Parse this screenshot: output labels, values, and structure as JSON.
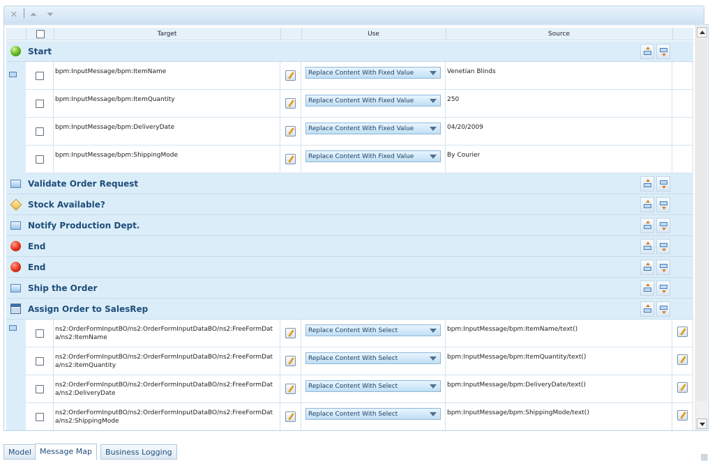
{
  "toolbar": {
    "delete_icon": "close-icon",
    "move_up_icon": "arrow-up-icon",
    "move_down_icon": "arrow-down-icon"
  },
  "columns": {
    "target": "Target",
    "use": "Use",
    "source": "Source"
  },
  "groups": {
    "start": "Start",
    "validate": "Validate Order Request",
    "stock": "Stock Available?",
    "notify": "Notify Production Dept.",
    "end1": "End",
    "end2": "End",
    "ship": "Ship the Order",
    "assign": "Assign Order to SalesRep"
  },
  "start_rows": [
    {
      "target": "bpm:InputMessage/bpm:ItemName",
      "use": "Replace Content With Fixed Value",
      "source": "Venetian Blinds"
    },
    {
      "target": "bpm:InputMessage/bpm:ItemQuantity",
      "use": "Replace Content With Fixed Value",
      "source": "250"
    },
    {
      "target": "bpm:InputMessage/bpm:DeliveryDate",
      "use": "Replace Content With Fixed Value",
      "source": "04/20/2009"
    },
    {
      "target": "bpm:InputMessage/bpm:ShippingMode",
      "use": "Replace Content With Fixed Value",
      "source": "By Courier"
    }
  ],
  "assign_rows": [
    {
      "target": "ns2:OrderFormInputBO/ns2:OrderFormInputDataBO/ns2:FreeFormData/ns2:ItemName",
      "use": "Replace Content With Select",
      "source": "bpm:InputMessage/bpm:ItemName/text()"
    },
    {
      "target": "ns2:OrderFormInputBO/ns2:OrderFormInputDataBO/ns2:FreeFormData/ns2:ItemQuantity",
      "use": "Replace Content With Select",
      "source": "bpm:InputMessage/bpm:ItemQuantity/text()"
    },
    {
      "target": "ns2:OrderFormInputBO/ns2:OrderFormInputDataBO/ns2:FreeFormData/ns2:DeliveryDate",
      "use": "Replace Content With Select",
      "source": "bpm:InputMessage/bpm:DeliveryDate/text()"
    },
    {
      "target": "ns2:OrderFormInputBO/ns2:OrderFormInputDataBO/ns2:FreeFormData/ns2:ShippingMode",
      "use": "Replace Content With Select",
      "source": "bpm:InputMessage/bpm:ShippingMode/text()"
    }
  ],
  "tabs": {
    "model": "Model",
    "message_map": "Message Map",
    "business_logging": "Business Logging"
  }
}
